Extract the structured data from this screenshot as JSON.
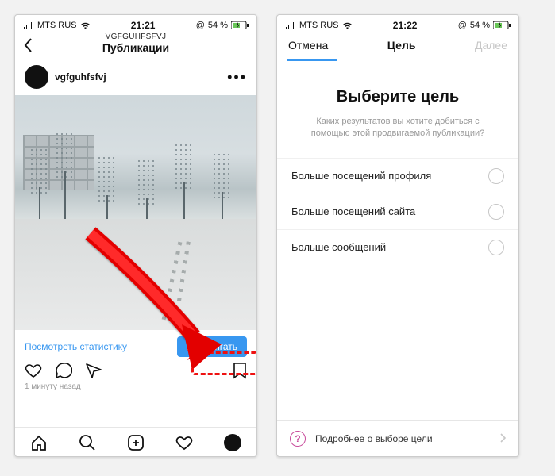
{
  "screen1": {
    "status": {
      "carrier": "MTS RUS",
      "time": "21:21",
      "battery": "54 %"
    },
    "header": {
      "username": "VGFGUHFSFVJ",
      "title": "Публикации"
    },
    "post": {
      "username": "vgfguhfsfvj"
    },
    "stats_link": "Посмотреть статистику",
    "promote_button": "Продвигать",
    "timestamp": "1 минуту назад"
  },
  "screen2": {
    "status": {
      "carrier": "MTS RUS",
      "time": "21:22",
      "battery": "54 %"
    },
    "header": {
      "cancel": "Отмена",
      "title": "Цель",
      "next": "Далее"
    },
    "goal_heading": "Выберите цель",
    "goal_sub": "Каких результатов вы хотите добиться с помощью этой продвигаемой публикации?",
    "options": [
      "Больше посещений профиля",
      "Больше посещений сайта",
      "Больше сообщений"
    ],
    "learn_more": "Подробнее о выборе цели"
  },
  "colors": {
    "accent": "#3897f0",
    "arrow": "#e30000"
  }
}
